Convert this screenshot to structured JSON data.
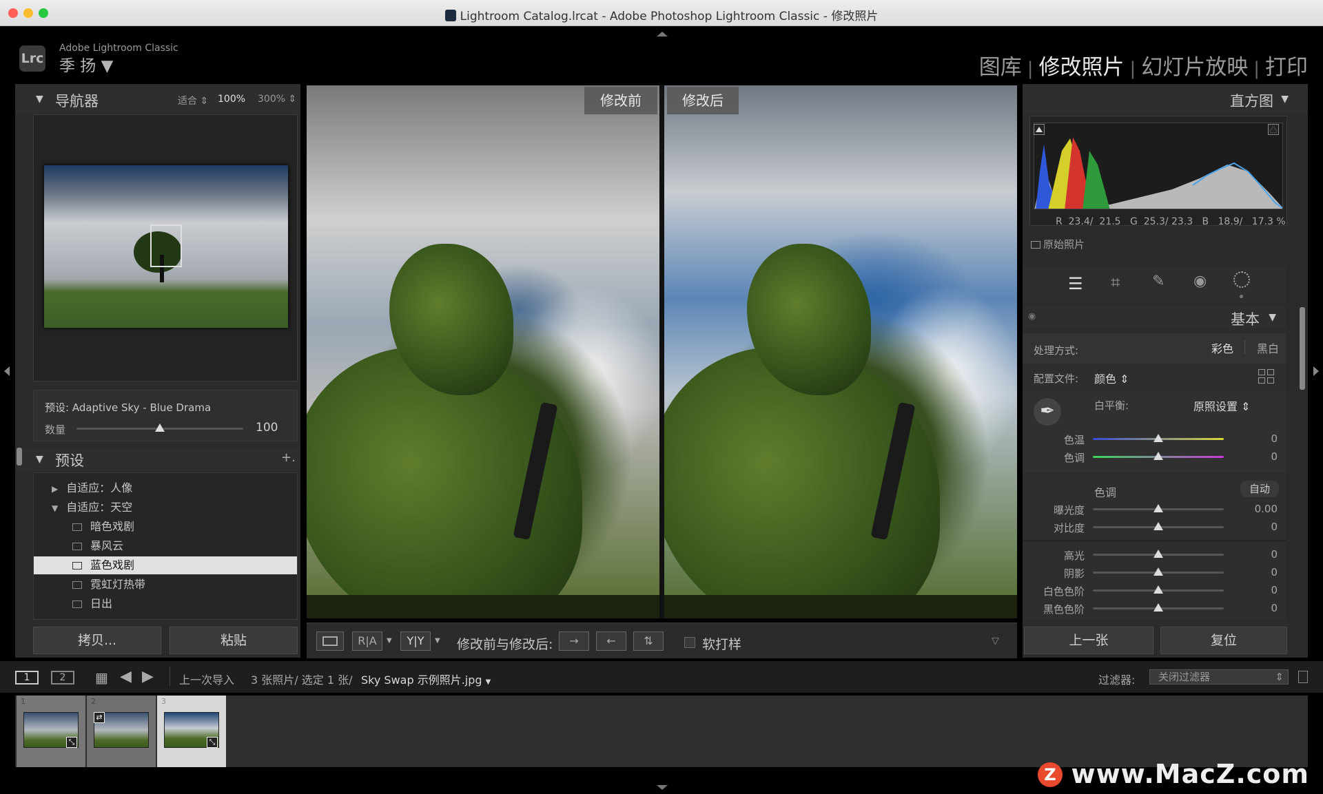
{
  "window": {
    "title": "Lightroom Catalog.lrcat - Adobe Photoshop Lightroom Classic - 修改照片"
  },
  "identity": {
    "logo": "Lrc",
    "brand": "Adobe Lightroom Classic",
    "user": "季 扬 ▼"
  },
  "modules": {
    "library": "图库",
    "develop": "修改照片",
    "slideshow": "幻灯片放映",
    "print": "打印",
    "active": "develop"
  },
  "navigator": {
    "title": "导航器",
    "zoom_fit": "适合",
    "zoom_100": "100%",
    "zoom_300": "300%"
  },
  "preset_amount": {
    "preset_label": "预设: Adaptive Sky - Blue Drama",
    "amount_label": "数量",
    "amount_value": "100",
    "amount_fraction": 0.5
  },
  "presets": {
    "title": "预设",
    "add": "+.",
    "items": [
      {
        "label": "自适应：人像",
        "type": "group",
        "expanded": false
      },
      {
        "label": "自适应：天空",
        "type": "group",
        "expanded": true
      },
      {
        "label": "暗色戏剧",
        "type": "preset"
      },
      {
        "label": "暴风云",
        "type": "preset"
      },
      {
        "label": "蓝色戏剧",
        "type": "preset",
        "selected": true
      },
      {
        "label": "霓虹灯热带",
        "type": "preset"
      },
      {
        "label": "日出",
        "type": "preset"
      }
    ]
  },
  "left_buttons": {
    "copy": "拷贝...",
    "paste": "粘贴"
  },
  "view": {
    "before_label": "修改前",
    "after_label": "修改后"
  },
  "toolbar": {
    "view_ra": "R|A",
    "view_yy": "Y|Y",
    "compare_label": "修改前与修改后:",
    "softproof": "软打样"
  },
  "histogram": {
    "title": "直方图",
    "readout": "R  23.4/  21.5   G  25.3/ 23.3   B   18.9/   17.3 %",
    "original_photo": "原始照片"
  },
  "tools": [
    "adjust-icon",
    "crop-icon",
    "heal-icon",
    "redeye-icon",
    "mask-icon"
  ],
  "basic": {
    "title": "基本",
    "treatment_label": "处理方式:",
    "treatment_color": "彩色",
    "treatment_bw": "黑白",
    "profile_label": "配置文件:",
    "profile_value": "颜色",
    "wb_label": "白平衡:",
    "wb_value": "原照设置",
    "temp": {
      "label": "色温",
      "value": "0"
    },
    "tint": {
      "label": "色调",
      "value": "0"
    },
    "tone_label": "色调",
    "tone_auto": "自动",
    "exposure": {
      "label": "曝光度",
      "value": "0.00"
    },
    "contrast": {
      "label": "对比度",
      "value": "0"
    },
    "highlights": {
      "label": "高光",
      "value": "0"
    },
    "shadows": {
      "label": "阴影",
      "value": "0"
    },
    "whites": {
      "label": "白色色阶",
      "value": "0"
    },
    "blacks": {
      "label": "黑色色阶",
      "value": "0"
    }
  },
  "right_buttons": {
    "previous": "上一张",
    "reset": "复位"
  },
  "filmbar": {
    "screen1": "1",
    "screen2": "2",
    "source": "上一次导入",
    "count": "3 张照片/ 选定 1 张/",
    "filename": "Sky Swap 示例照片.jpg",
    "filter_label": "过滤器:",
    "filter_value": "关闭过滤器"
  },
  "filmstrip": [
    {
      "index": "1",
      "selected": false
    },
    {
      "index": "2",
      "selected": false
    },
    {
      "index": "3",
      "selected": true
    }
  ],
  "watermark": {
    "logo": "Z",
    "text": "www.MacZ.com"
  },
  "colors": {
    "accent_active": "#e8e8e8",
    "panel": "#2e2e2e",
    "selected_row": "#e0e0e0"
  }
}
